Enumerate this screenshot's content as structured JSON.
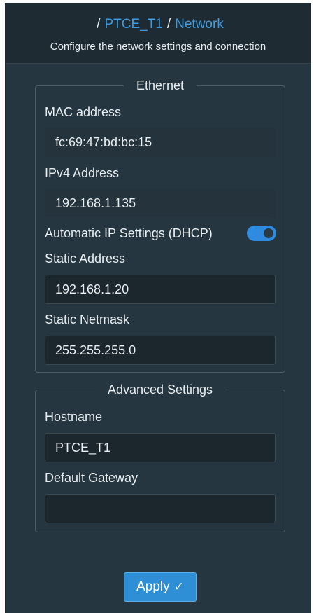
{
  "header": {
    "breadcrumb_sep": "/",
    "device": "PTCE_T1",
    "page": "Network",
    "subtitle": "Configure the network settings and connection"
  },
  "ethernet": {
    "legend": "Ethernet",
    "mac_label": "MAC address",
    "mac_value": "fc:69:47:bd:bc:15",
    "ipv4_label": "IPv4 Address",
    "ipv4_value": "192.168.1.135",
    "dhcp_label": "Automatic IP Settings (DHCP)",
    "dhcp_enabled": true,
    "static_address_label": "Static Address",
    "static_address_value": "192.168.1.20",
    "static_netmask_label": "Static Netmask",
    "static_netmask_value": "255.255.255.0"
  },
  "advanced": {
    "legend": "Advanced Settings",
    "hostname_label": "Hostname",
    "hostname_value": "PTCE_T1",
    "gateway_label": "Default Gateway",
    "gateway_value": ""
  },
  "actions": {
    "apply_label": "Apply",
    "apply_icon": "check-icon"
  },
  "colors": {
    "accent": "#2e8fd6",
    "link": "#3e9be0",
    "background": "#263640"
  }
}
